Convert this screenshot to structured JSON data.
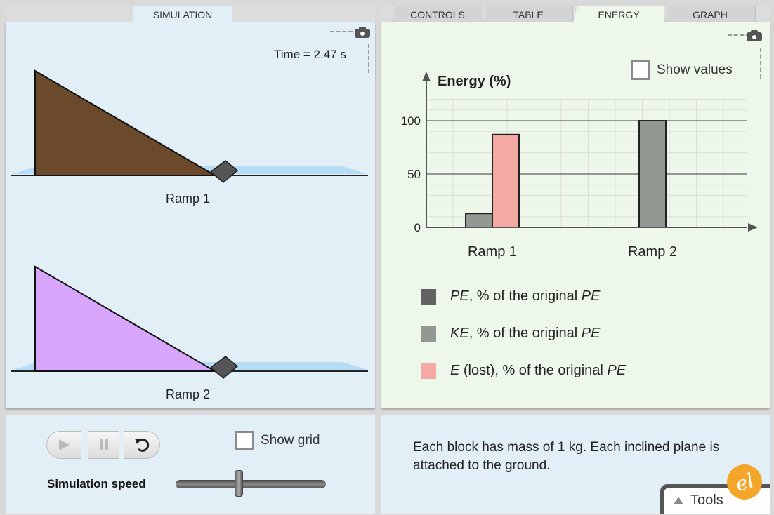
{
  "tabs": {
    "left": [
      {
        "label": "SIMULATION",
        "active": true
      }
    ],
    "right": [
      {
        "label": "CONTROLS",
        "active": false
      },
      {
        "label": "TABLE",
        "active": false
      },
      {
        "label": "ENERGY",
        "active": true
      },
      {
        "label": "GRAPH",
        "active": false
      }
    ]
  },
  "simulation": {
    "time_label": "Time = 2.47 s",
    "ramps": [
      {
        "label": "Ramp 1",
        "color": "#6b4a2b"
      },
      {
        "label": "Ramp 2",
        "color": "#d7a6fb"
      }
    ]
  },
  "energy": {
    "show_values_label": "Show values",
    "show_values_checked": false,
    "legend": [
      {
        "prefix": "PE",
        "middle": ", % of the original ",
        "suffix": "PE",
        "color": "#606361"
      },
      {
        "prefix": "KE",
        "middle": ", % of the original ",
        "suffix": "PE",
        "color": "#949893"
      },
      {
        "prefix": "E",
        "middle": " (lost), % of the original ",
        "suffix": "PE",
        "color": "#f4a9a5"
      }
    ]
  },
  "chart_data": {
    "type": "bar",
    "title": "",
    "ylabel": "Energy (%)",
    "xlabel": "",
    "categories": [
      "Ramp 1",
      "Ramp 2"
    ],
    "ylim": [
      0,
      120
    ],
    "yticks": [
      0,
      50,
      100
    ],
    "grid": true,
    "series": [
      {
        "name": "PE, % of the original PE",
        "values": [
          0,
          0
        ],
        "color": "#606361"
      },
      {
        "name": "KE, % of the original PE",
        "values": [
          13,
          100
        ],
        "color": "#949893"
      },
      {
        "name": "E (lost), % of the original PE",
        "values": [
          87,
          0
        ],
        "color": "#f4a9a5"
      }
    ]
  },
  "controls": {
    "show_grid_label": "Show grid",
    "show_grid_checked": false,
    "speed_label": "Simulation speed",
    "speed_level": 0.42
  },
  "description": "Each block has mass of 1 kg. Each inclined plane is attached to the ground.",
  "tools": {
    "label": "Tools",
    "logo": "el"
  }
}
